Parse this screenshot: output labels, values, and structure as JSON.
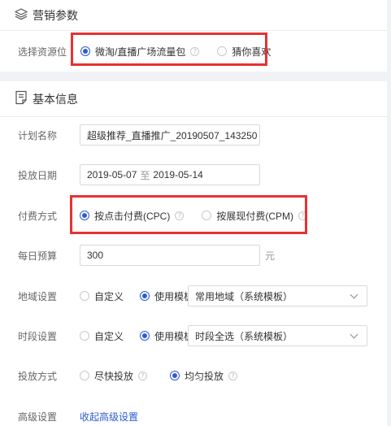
{
  "marketing": {
    "title": "营销参数",
    "resource_label": "选择资源位",
    "options": [
      {
        "label": "微淘/直播广场流量包",
        "selected": true
      },
      {
        "label": "猜你喜欢",
        "selected": false
      }
    ]
  },
  "basic": {
    "title": "基本信息",
    "plan_name": {
      "label": "计划名称",
      "value": "超级推荐_直播推广_20190507_143250"
    },
    "date": {
      "label": "投放日期",
      "start": "2019-05-07",
      "sep": "至",
      "end": "2019-05-14"
    },
    "payment": {
      "label": "付费方式",
      "options": [
        {
          "label": "按点击付费(CPC)",
          "selected": true
        },
        {
          "label": "按展现付费(CPM)",
          "selected": false
        }
      ]
    },
    "budget": {
      "label": "每日预算",
      "value": "300",
      "unit": "元"
    },
    "region": {
      "label": "地域设置",
      "custom_label": "自定义",
      "template_label": "使用模板",
      "template_selected": true,
      "select_value": "常用地域（系统模板）"
    },
    "time": {
      "label": "时段设置",
      "custom_label": "自定义",
      "template_label": "使用模板",
      "template_selected": true,
      "select_value": "时段全选（系统模板）"
    },
    "delivery": {
      "label": "投放方式",
      "options": [
        {
          "label": "尽快投放",
          "selected": false
        },
        {
          "label": "均匀投放",
          "selected": true
        }
      ]
    },
    "advanced": {
      "label": "高级设置",
      "link": "收起高级设置"
    }
  },
  "colors": {
    "accent": "#2d5bd3",
    "highlight": "#e63232"
  },
  "icons": {
    "marketing": "layers-icon",
    "basic": "document-icon",
    "help": "question-circle-icon"
  }
}
